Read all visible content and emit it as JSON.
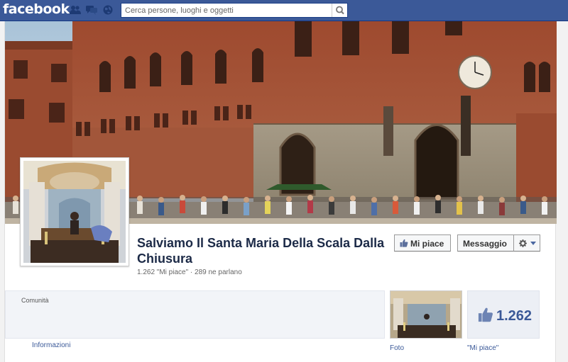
{
  "topbar": {
    "logo": "facebook",
    "search_placeholder": "Cerca persone, luoghi e oggetti"
  },
  "page": {
    "title": "Salviamo Il Santa Maria Della Scala Dalla Chiusura",
    "stats": "1.262 \"Mi piace\" · 289 ne parlano",
    "like_button": "Mi piace",
    "message_button": "Messaggio",
    "category": "Comunità",
    "info_link": "Informazioni",
    "photos_label": "Foto",
    "likes_label": "\"Mi piace\"",
    "likes_count": "1.262"
  },
  "colors": {
    "brand": "#3b5998",
    "title": "#1c2a47"
  }
}
